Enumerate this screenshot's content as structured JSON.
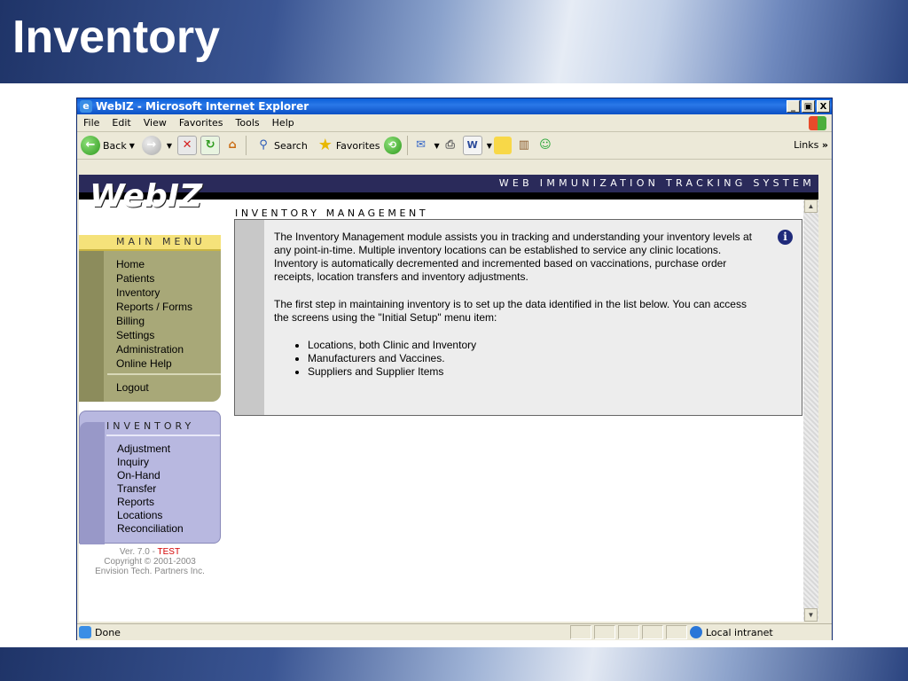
{
  "slide": {
    "title": "Inventory"
  },
  "window": {
    "title": "WebIZ - Microsoft Internet Explorer",
    "controls": {
      "minimize": "_",
      "maximize": "̅❐",
      "close": "X"
    }
  },
  "menubar": [
    "File",
    "Edit",
    "View",
    "Favorites",
    "Tools",
    "Help"
  ],
  "toolbar": {
    "back": "Back",
    "search": "Search",
    "favorites": "Favorites",
    "links": "Links",
    "links_chevron": "»"
  },
  "site": {
    "logo": "WebIZ",
    "banner": "WEB IMMUNIZATION TRACKING SYSTEM"
  },
  "main_menu": {
    "header": "MAIN MENU",
    "items": [
      "Home",
      "Patients",
      "Inventory",
      "Reports / Forms",
      "Billing",
      "Settings",
      "Administration",
      "Online Help"
    ],
    "logout": "Logout"
  },
  "inventory_menu": {
    "header": "INVENTORY",
    "items": [
      "Adjustment",
      "Inquiry",
      "On-Hand",
      "Transfer",
      "Reports",
      "Locations",
      "Reconciliation"
    ]
  },
  "version": {
    "prefix": "Ver. 7.0 - ",
    "env": "TEST",
    "copyright": "Copyright © 2001-2003",
    "company": "Envision Tech. Partners Inc."
  },
  "inventory_management": {
    "title": "INVENTORY MANAGEMENT",
    "para1": "The Inventory Management module assists you in tracking and understanding your inventory levels at any point-in-time. Multiple inventory locations can be established to service any clinic locations. Inventory is automatically decremented and incremented based on vaccinations, purchase order receipts, location transfers and inventory adjustments.",
    "para2": "The first step in maintaining inventory is to set up the data identified in the list below. You can access the screens using the \"Initial Setup\" menu item:",
    "list": [
      "Locations, both Clinic and Inventory",
      "Manufacturers and Vaccines.",
      "Suppliers and Supplier Items"
    ],
    "info_glyph": "i"
  },
  "statusbar": {
    "status": "Done",
    "zone": "Local intranet"
  }
}
